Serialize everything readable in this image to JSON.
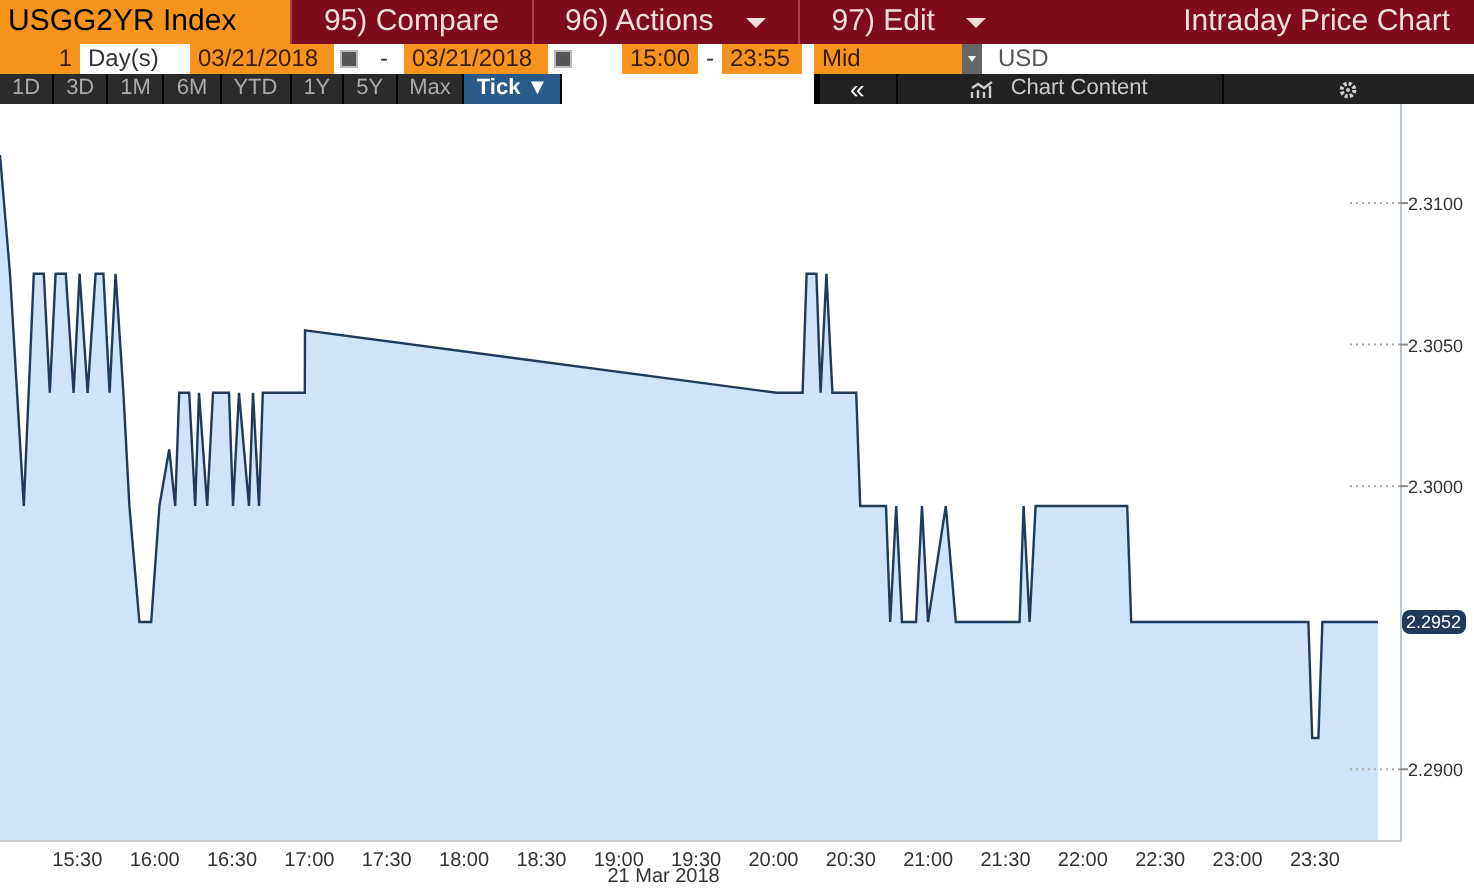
{
  "header": {
    "security": "USGG2YR Index",
    "menu": [
      {
        "label": "95) Compare",
        "dropdown": false
      },
      {
        "label": "96) Actions",
        "dropdown": true
      },
      {
        "label": "97) Edit",
        "dropdown": true
      }
    ],
    "title": "Intraday Price Chart"
  },
  "period": {
    "count": "1",
    "unit": "Day(s)",
    "start_date": "03/21/2018",
    "end_date": "03/21/2018",
    "separator": "-",
    "start_time": "15:00",
    "end_time": "23:55",
    "price_type": "Mid",
    "currency": "USD"
  },
  "ranges": [
    {
      "label": "1D",
      "selected": false
    },
    {
      "label": "3D",
      "selected": false
    },
    {
      "label": "1M",
      "selected": false
    },
    {
      "label": "6M",
      "selected": false
    },
    {
      "label": "YTD",
      "selected": false
    },
    {
      "label": "1Y",
      "selected": false
    },
    {
      "label": "5Y",
      "selected": false
    },
    {
      "label": "Max",
      "selected": false
    },
    {
      "label": "Tick ▼",
      "selected": true
    }
  ],
  "toolbar": {
    "collapse": "«",
    "chart_content": "Chart Content"
  },
  "last_price_label": "2.2952",
  "date_label": "21 Mar 2018",
  "chart_data": {
    "type": "area",
    "x": [
      15.0,
      15.064,
      15.154,
      15.219,
      15.283,
      15.322,
      15.36,
      15.425,
      15.476,
      15.515,
      15.566,
      15.618,
      15.669,
      15.708,
      15.747,
      15.798,
      15.837,
      15.901,
      15.978,
      16.03,
      16.094,
      16.133,
      16.159,
      16.223,
      16.262,
      16.287,
      16.339,
      16.377,
      16.48,
      16.506,
      16.545,
      16.609,
      16.635,
      16.674,
      16.699,
      16.97,
      16.971,
      20.021,
      20.188,
      20.214,
      20.278,
      20.304,
      20.342,
      20.381,
      20.535,
      20.561,
      20.728,
      20.754,
      20.793,
      20.831,
      20.921,
      20.96,
      20.999,
      21.114,
      21.179,
      21.591,
      21.617,
      21.655,
      21.694,
      22.286,
      22.312,
      23.458,
      23.483,
      23.522,
      23.548,
      23.908
    ],
    "series": [
      {
        "color": "#1f3a5a",
        "values": [
          2.3117,
          2.3075,
          2.2993,
          2.3075,
          2.3075,
          2.3033,
          2.3075,
          2.3075,
          2.3033,
          2.3075,
          2.3033,
          2.3075,
          2.3075,
          2.3033,
          2.3075,
          2.3033,
          2.2993,
          2.2952,
          2.2952,
          2.2993,
          2.3013,
          2.2993,
          2.3033,
          2.3033,
          2.2993,
          2.3033,
          2.2993,
          2.3033,
          2.3033,
          2.2993,
          2.3033,
          2.2993,
          2.3033,
          2.2993,
          2.3033,
          2.3033,
          2.3055,
          2.3033,
          2.3033,
          2.3075,
          2.3075,
          2.3033,
          2.3075,
          2.3033,
          2.3033,
          2.2993,
          2.2993,
          2.2952,
          2.2993,
          2.2952,
          2.2952,
          2.2993,
          2.2952,
          2.2993,
          2.2952,
          2.2952,
          2.2993,
          2.2952,
          2.2993,
          2.2993,
          2.2952,
          2.2952,
          2.2911,
          2.2911,
          2.2952,
          2.2952
        ]
      }
    ],
    "ylim": [
      2.2875,
      2.3135
    ],
    "xlim": [
      15.0,
      24.05
    ],
    "yticks": [
      {
        "value": 2.31,
        "label": "2.3100"
      },
      {
        "value": 2.305,
        "label": "2.3050"
      },
      {
        "value": 2.3,
        "label": "2.3000"
      },
      {
        "value": 2.29,
        "label": "2.2900"
      }
    ],
    "xticks": [
      {
        "value": 15.5,
        "label": "15:30"
      },
      {
        "value": 16,
        "label": "16:00"
      },
      {
        "value": 16.5,
        "label": "16:30"
      },
      {
        "value": 17,
        "label": "17:00"
      },
      {
        "value": 17.5,
        "label": "17:30"
      },
      {
        "value": 18,
        "label": "18:00"
      },
      {
        "value": 18.5,
        "label": "18:30"
      },
      {
        "value": 19,
        "label": "19:00"
      },
      {
        "value": 19.5,
        "label": "19:30"
      },
      {
        "value": 20,
        "label": "20:00"
      },
      {
        "value": 20.5,
        "label": "20:30"
      },
      {
        "value": 21,
        "label": "21:00"
      },
      {
        "value": 21.5,
        "label": "21:30"
      },
      {
        "value": 22,
        "label": "22:00"
      },
      {
        "value": 22.5,
        "label": "22:30"
      },
      {
        "value": 23,
        "label": "23:00"
      },
      {
        "value": 23.5,
        "label": "23:30"
      }
    ]
  }
}
